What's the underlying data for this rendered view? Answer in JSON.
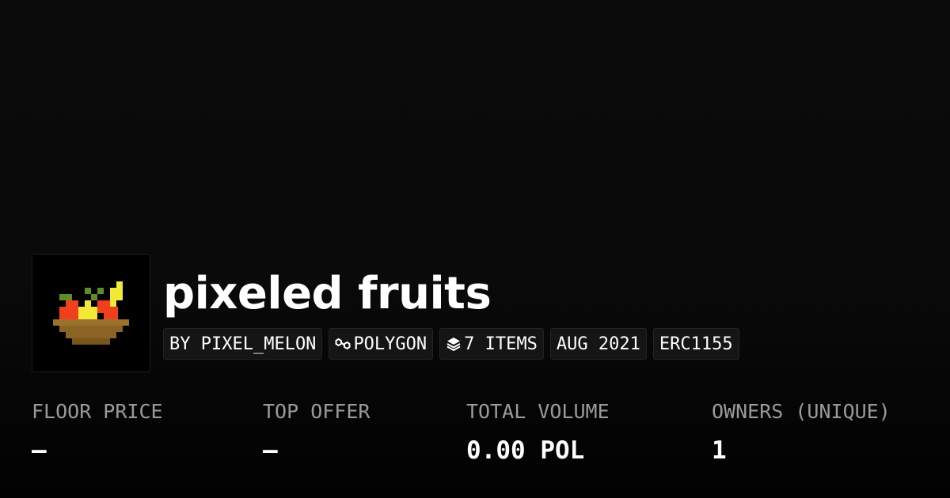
{
  "collection": {
    "title": "pixeled fruits",
    "avatar_icon": "pixel-fruit-bowl"
  },
  "badges": [
    {
      "label": "BY PIXEL_MELON",
      "icon": ""
    },
    {
      "label": "POLYGON",
      "icon": "polygon-chain-icon"
    },
    {
      "label": "7 ITEMS",
      "icon": "layers-icon"
    },
    {
      "label": "AUG 2021",
      "icon": ""
    },
    {
      "label": "ERC1155",
      "icon": ""
    }
  ],
  "stats": [
    {
      "label": "FLOOR PRICE",
      "value": "–"
    },
    {
      "label": "TOP OFFER",
      "value": "–"
    },
    {
      "label": "TOTAL VOLUME",
      "value": "0.00 POL"
    },
    {
      "label": "OWNERS (UNIQUE)",
      "value": "1"
    }
  ],
  "colors": {
    "background": "#0a0a0a",
    "badge_background": "#151515",
    "label": "#9a9a9a",
    "value": "#ffffff",
    "bowl": "#9b722c",
    "red_fruit": "#f2401f",
    "yellow_fruit": "#f2e836",
    "leaf": "#5e8c2b"
  }
}
